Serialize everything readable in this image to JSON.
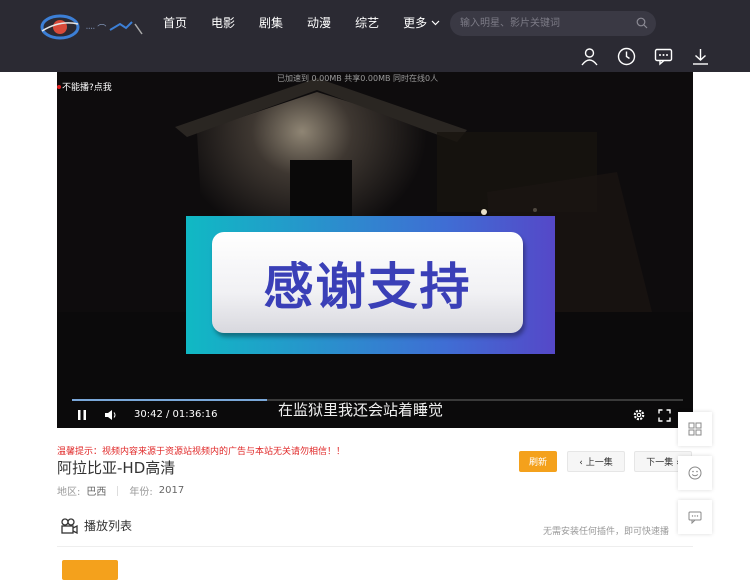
{
  "nav": {
    "items": [
      "首页",
      "电影",
      "剧集",
      "动漫",
      "综艺"
    ],
    "more_label": "更多"
  },
  "search": {
    "placeholder": "输入明星、影片关键词"
  },
  "player": {
    "hint_text": "不能播?点我",
    "stats_text": "已加速到 0.00MB 共享0.00MB 同时在线0人",
    "ad_text": "感谢支持",
    "subtitle": "在监狱里我还会站着睡觉",
    "time_current": "30:42",
    "time_total": "01:36:16",
    "time_display": "30:42 / 01:36:16",
    "progress": 0.319
  },
  "info": {
    "notice": "温馨提示：视频内容来源于资源站视频内的广告与本站无关请勿相信！！",
    "title": "阿拉比亚-HD高清",
    "region_label": "地区:",
    "region_value": "巴西",
    "year_label": "年份:",
    "year_value": "2017"
  },
  "buttons": {
    "refresh": "刷新",
    "prev": "‹ 上一集",
    "next": "下一集 ›"
  },
  "playlist": {
    "title": "播放列表",
    "no_plugin": "无需安装任何插件，即可快速播"
  },
  "colors": {
    "accent": "#f4a11c",
    "topbar": "#2b2a33",
    "notice": "#e02828"
  },
  "icons": {
    "header": [
      "user-icon",
      "history-icon",
      "message-icon",
      "download-icon"
    ],
    "side": [
      "grid-icon",
      "smile-icon",
      "comment-icon"
    ]
  }
}
